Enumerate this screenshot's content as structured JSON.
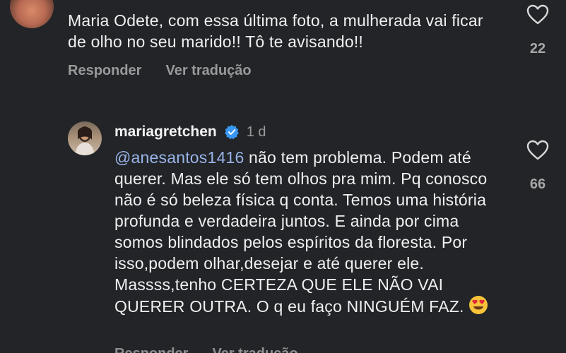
{
  "comments": [
    {
      "text": "Maria Odete, com essa última foto, a mulherada vai ficar de olho no seu marido!! Tô te avisando!!",
      "likes": "22",
      "reply_label": "Responder",
      "translate_label": "Ver tradução"
    },
    {
      "username": "mariagretchen",
      "time": "1 d",
      "mention": "@anesantos1416",
      "text": " não tem problema. Podem até querer. Mas ele só tem olhos pra mim. Pq conosco não é só beleza física q conta. Temos uma história profunda e verdadeira juntos. E ainda por cima somos blindados pelos espíritos da floresta. Por isso,podem olhar,desejar e até querer ele. Massss,tenho CERTEZA QUE ELE NÃO VAI QUERER OUTRA. O q eu faço NINGUÉM FAZ.",
      "likes": "66",
      "reply_label": "Responder",
      "translate_label": "Ver tradução"
    }
  ],
  "colors": {
    "background": "#222428",
    "mention": "#9ab4e8",
    "verified": "#3897f0",
    "secondary_text": "#9a9a9a"
  },
  "icons": [
    "heart-outline-icon",
    "verified-badge-icon",
    "heart-eyes-emoji"
  ]
}
